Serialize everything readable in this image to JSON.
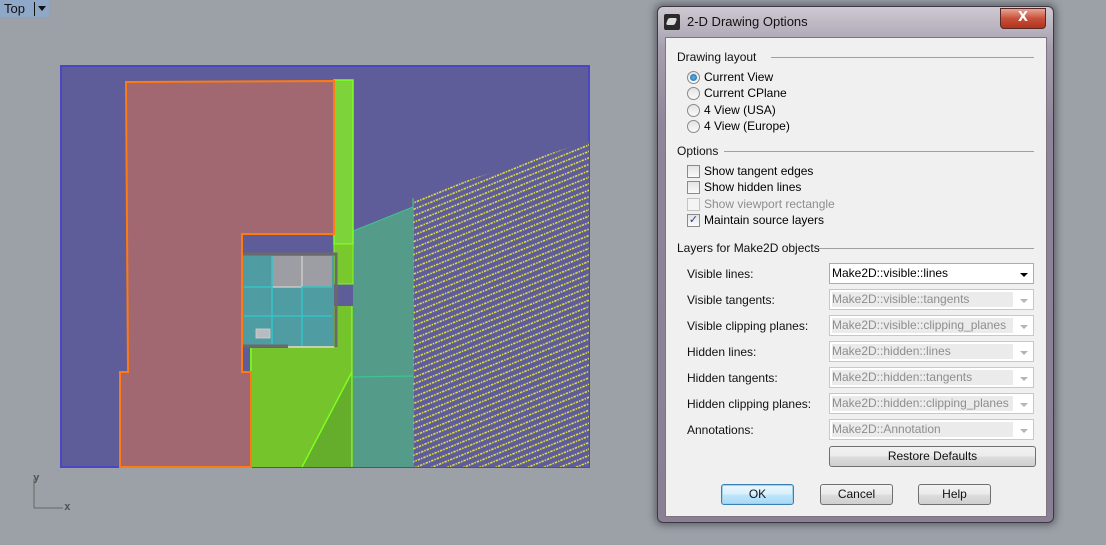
{
  "viewport": {
    "name": "Top",
    "axes": {
      "x": "x",
      "y": "y"
    },
    "colors": {
      "background": "#9ca1a8",
      "site": "#5e5c99",
      "building": "#a26871",
      "building_outline": "#ff7a10",
      "green": "#79c92e",
      "green_outline": "#7dff1e",
      "teal": "#559b8a",
      "hatch": "#e6e63c",
      "room": "#4f9da3",
      "room_grid": "#33c3c8",
      "wall": "#6a6a6a",
      "grey_tile": "#9d9ea3"
    }
  },
  "dialog": {
    "title": "2-D Drawing Options",
    "close_label": "X",
    "drawing_layout": {
      "label": "Drawing layout",
      "options": [
        {
          "label": "Current View",
          "selected": true
        },
        {
          "label": "Current CPlane",
          "selected": false
        },
        {
          "label": "4 View (USA)",
          "selected": false
        },
        {
          "label": "4 View (Europe)",
          "selected": false
        }
      ]
    },
    "options": {
      "label": "Options",
      "items": [
        {
          "label": "Show tangent edges",
          "checked": false,
          "enabled": true
        },
        {
          "label": "Show hidden lines",
          "checked": false,
          "enabled": true
        },
        {
          "label": "Show viewport rectangle",
          "checked": false,
          "enabled": false
        },
        {
          "label": "Maintain source layers",
          "checked": true,
          "enabled": true
        }
      ]
    },
    "layers": {
      "label": "Layers for Make2D objects",
      "rows": [
        {
          "label": "Visible lines:",
          "value": "Make2D::visible::lines",
          "enabled": true
        },
        {
          "label": "Visible tangents:",
          "value": "Make2D::visible::tangents",
          "enabled": false
        },
        {
          "label": "Visible clipping planes:",
          "value": "Make2D::visible::clipping_planes",
          "enabled": false
        },
        {
          "label": "Hidden lines:",
          "value": "Make2D::hidden::lines",
          "enabled": false
        },
        {
          "label": "Hidden tangents:",
          "value": "Make2D::hidden::tangents",
          "enabled": false
        },
        {
          "label": "Hidden clipping planes:",
          "value": "Make2D::hidden::clipping_planes",
          "enabled": false
        },
        {
          "label": "Annotations:",
          "value": "Make2D::Annotation",
          "enabled": false
        }
      ]
    },
    "restore_defaults_label": "Restore Defaults",
    "ok_label": "OK",
    "cancel_label": "Cancel",
    "help_label": "Help"
  }
}
